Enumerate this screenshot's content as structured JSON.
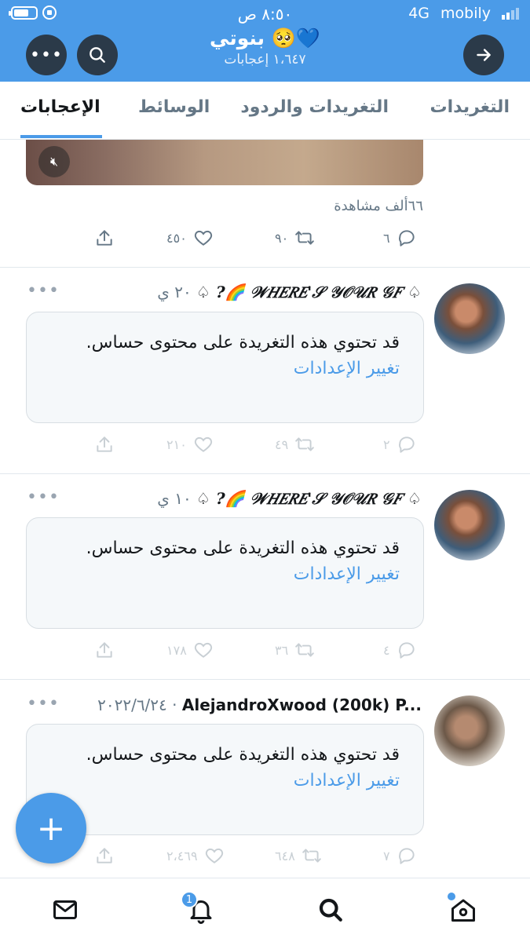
{
  "status": {
    "time": "٨:٥٠ ص",
    "network": "4G",
    "carrier": "mobily"
  },
  "header": {
    "title": "بنوتي 🥺💙",
    "subtitle": "١،٦٤٧ إعجابات"
  },
  "tabs": [
    {
      "label": "التغريدات",
      "active": false
    },
    {
      "label": "التغريدات والردود",
      "active": false
    },
    {
      "label": "الوسائط",
      "active": false
    },
    {
      "label": "الإعجابات",
      "active": true
    }
  ],
  "first_tweet": {
    "views": "٦٦ألف مشاهدة",
    "replies": "٦",
    "retweets": "٩٠",
    "likes": "٤٥٠"
  },
  "tweets": [
    {
      "name": "♤ ?🌈 𝒲𝐻𝐸𝑅𝐸'𝒮 𝒴𝒪𝒰𝑅 𝒢𝐹 ♤",
      "time": "٢٠ ي",
      "message": "قد تحتوي هذه التغريدة على محتوى حساس.",
      "link": "تغيير الإعدادات",
      "replies": "٢",
      "retweets": "٤٩",
      "likes": "٢١٠"
    },
    {
      "name": "♤ ?🌈 𝒲𝐻𝐸𝑅𝐸'𝒮 𝒴𝒪𝒰𝑅 𝒢𝐹 ♤",
      "time": "١٠ ي",
      "message": "قد تحتوي هذه التغريدة على محتوى حساس.",
      "link": "تغيير الإعدادات",
      "replies": "٤",
      "retweets": "٣٦",
      "likes": "١٧٨"
    },
    {
      "name": "AlejandroXwood (200k) P...",
      "time": "٢٠٢٢/٦/٢٤ ·",
      "message": "قد تحتوي هذه التغريدة على محتوى حساس.",
      "link": "تغيير الإعدادات",
      "replies": "٧",
      "retweets": "٦٤٨",
      "likes": "٢،٤٦٩"
    }
  ],
  "nav": {
    "notifications_badge": "1"
  },
  "colors": {
    "accent": "#4b9be8",
    "header_button": "#2b3a49",
    "muted": "#657786"
  }
}
